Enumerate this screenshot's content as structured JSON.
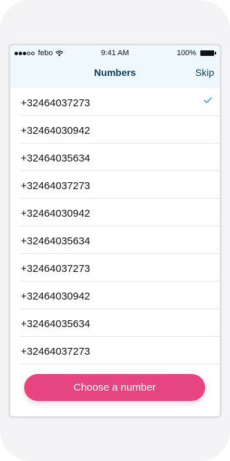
{
  "status_bar": {
    "carrier": "febo",
    "time": "9:41 AM",
    "battery": "100%"
  },
  "nav": {
    "title": "Numbers",
    "skip_label": "Skip"
  },
  "numbers": [
    {
      "label": "+32464037273",
      "selected": true
    },
    {
      "label": "+32464030942",
      "selected": false
    },
    {
      "label": "+32464035634",
      "selected": false
    },
    {
      "label": "+32464037273",
      "selected": false
    },
    {
      "label": "+32464030942",
      "selected": false
    },
    {
      "label": "+32464035634",
      "selected": false
    },
    {
      "label": "+32464037273",
      "selected": false
    },
    {
      "label": "+32464030942",
      "selected": false
    },
    {
      "label": "+32464035634",
      "selected": false
    },
    {
      "label": "+32464037273",
      "selected": false
    }
  ],
  "cta": {
    "label": "Choose a number"
  },
  "colors": {
    "accent": "#e6457f",
    "nav_text": "#0b3b5e",
    "header_bg": "#eff8fc",
    "check": "#2ea6e0"
  },
  "icons": {
    "selected": "checkmark-icon",
    "wifi": "wifi-icon",
    "battery": "battery-icon",
    "signal": "signal-strength-icon"
  }
}
